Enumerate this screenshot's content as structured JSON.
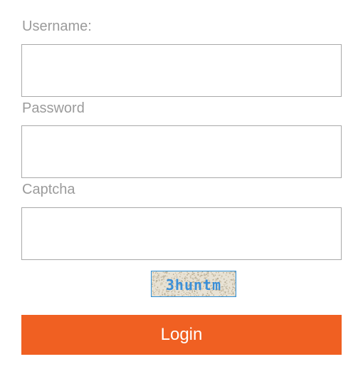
{
  "form": {
    "username": {
      "label": "Username:",
      "value": ""
    },
    "password": {
      "label": "Password",
      "value": ""
    },
    "captcha": {
      "label": "Captcha",
      "value": ""
    },
    "captcha_image": {
      "text": "3huntm",
      "text_color": "#3a8fd8",
      "noise_color": "#c4b69a",
      "border_color": "#2d8fd8"
    },
    "login_button": {
      "label": "Login",
      "color": "#f06022"
    }
  }
}
